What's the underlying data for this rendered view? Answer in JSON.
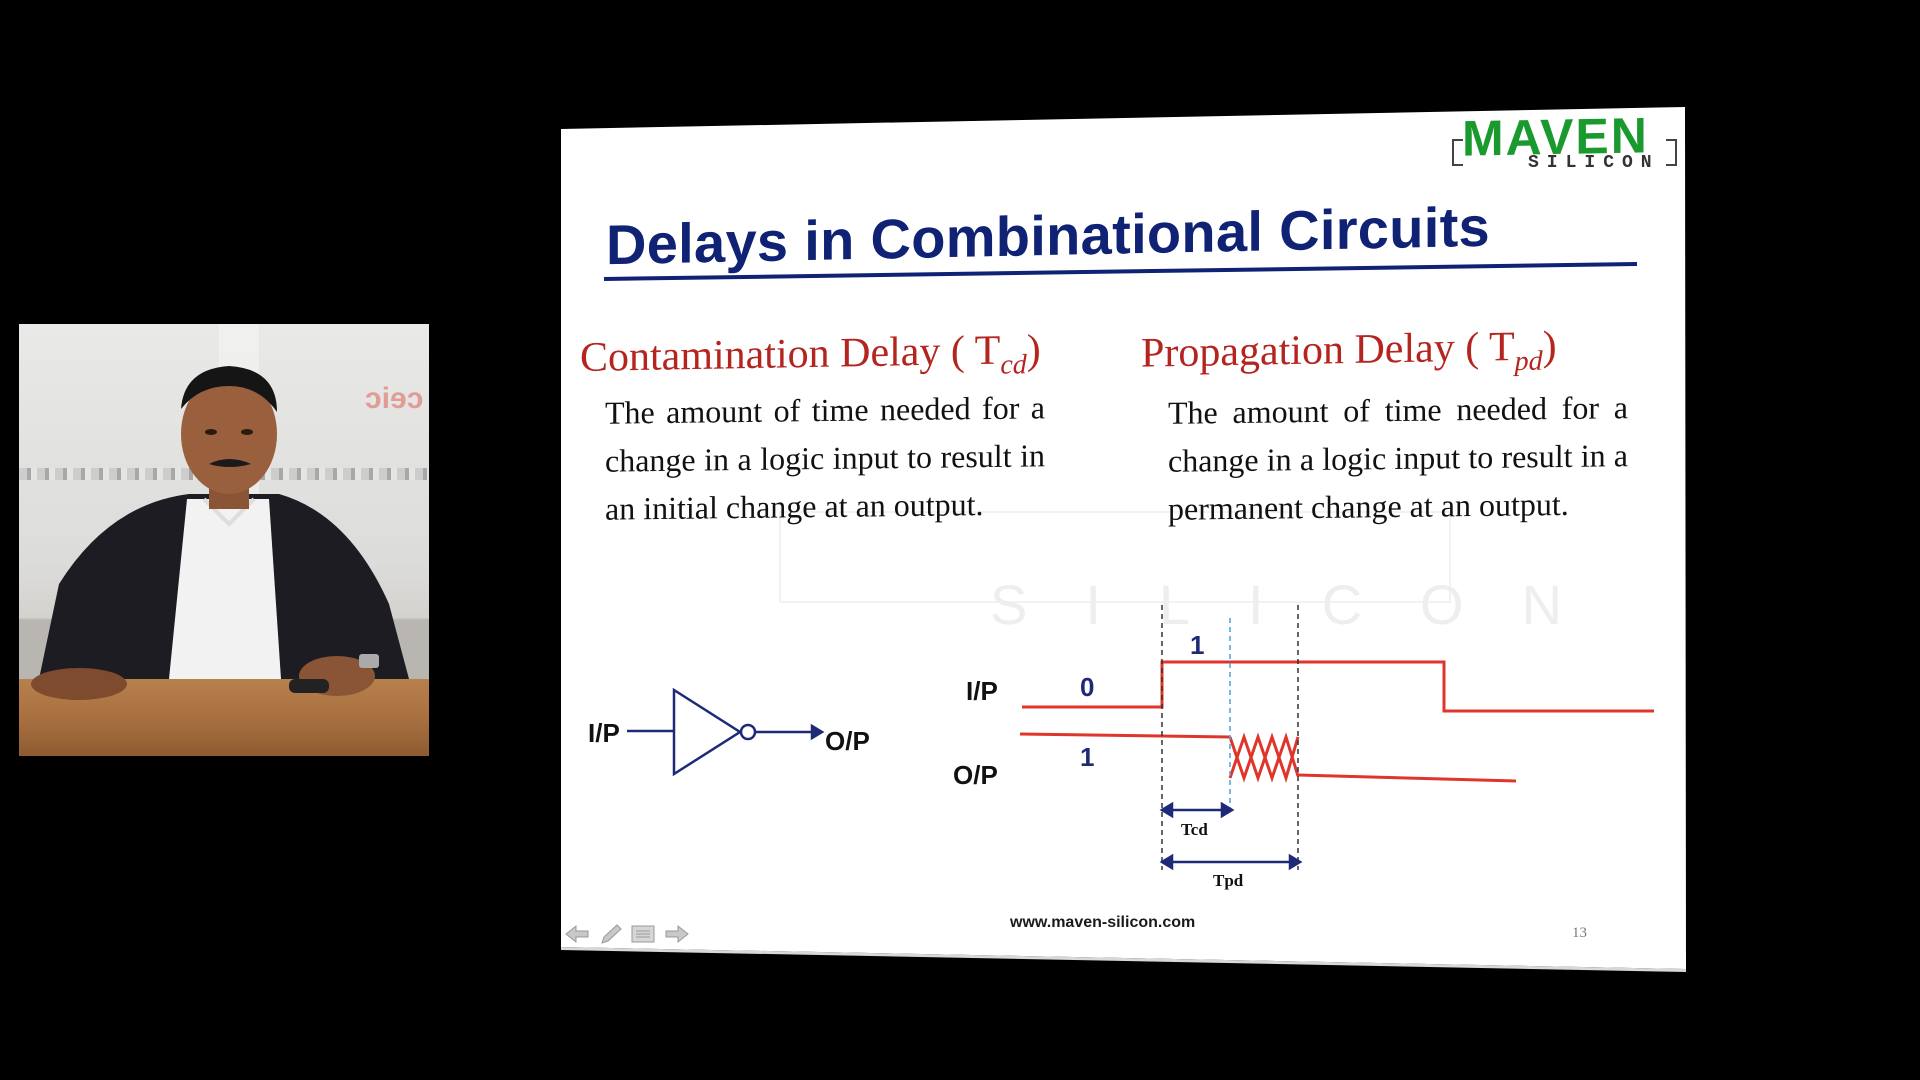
{
  "slide": {
    "title": "Delays in Combinational Circuits",
    "brand": {
      "name": "MAVEN",
      "sub": "SILICON"
    },
    "watermark": "SILICON",
    "left_heading": {
      "text": "Contamination Delay ( T",
      "subscript": "cd",
      "close": ")"
    },
    "left_body": "The amount of time needed for a change in a logic input to result in an initial change at an output.",
    "right_heading": {
      "text": "Propagation Delay ( T",
      "subscript": "pd",
      "close": ")"
    },
    "right_body": "The amount of time needed for a change in a logic input to result in a permanent change at an output.",
    "inverter": {
      "input_label": "I/P",
      "output_label": "O/P"
    },
    "timing": {
      "input_label": "I/P",
      "output_label": "O/P",
      "in_low": "0",
      "in_high": "1",
      "out_high": "1",
      "tcd": "Tcd",
      "tpd": "Tpd"
    },
    "footer_url": "www.maven-silicon.com",
    "page_number": "13"
  },
  "colors": {
    "title": "#0f2273",
    "heading": "#b4251f",
    "waveform": "#e0352b",
    "logo_green": "#1a9a2e",
    "diagram_blue": "#1e2a78"
  },
  "nav_icons": [
    "prev-arrow-icon",
    "pen-icon",
    "menu-icon",
    "next-arrow-icon"
  ]
}
